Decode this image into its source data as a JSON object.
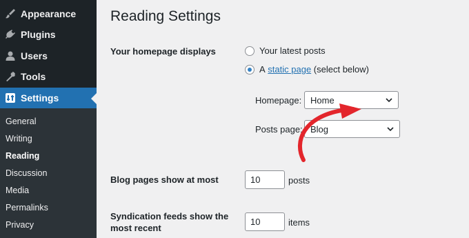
{
  "sidebar": {
    "menu": [
      {
        "label": "Appearance",
        "icon": "paintbrush-icon"
      },
      {
        "label": "Plugins",
        "icon": "plug-icon"
      },
      {
        "label": "Users",
        "icon": "user-icon"
      },
      {
        "label": "Tools",
        "icon": "wrench-icon"
      },
      {
        "label": "Settings",
        "icon": "settings-icon",
        "active": true
      }
    ],
    "submenu": [
      "General",
      "Writing",
      "Reading",
      "Discussion",
      "Media",
      "Permalinks",
      "Privacy"
    ],
    "current_submenu": "Reading"
  },
  "page": {
    "title": "Reading Settings",
    "homepage_displays": {
      "label": "Your homepage displays",
      "option_latest": "Your latest posts",
      "option_static_prefix": "A",
      "option_static_link": "static page",
      "option_static_suffix": "(select below)",
      "selected": "static page"
    },
    "homepage_select": {
      "label": "Homepage:",
      "value": "Home"
    },
    "posts_page_select": {
      "label": "Posts page:",
      "value": "Blog"
    },
    "blog_pages": {
      "label": "Blog pages show at most",
      "value": "10",
      "unit": "posts"
    },
    "syndication": {
      "label_line1": "Syndication feeds show the",
      "label_line2": "most recent",
      "value": "10",
      "unit": "items"
    }
  },
  "colors": {
    "sidebar_bg": "#1d2327",
    "accent": "#2271b1",
    "annotation_arrow": "#e3262c"
  }
}
